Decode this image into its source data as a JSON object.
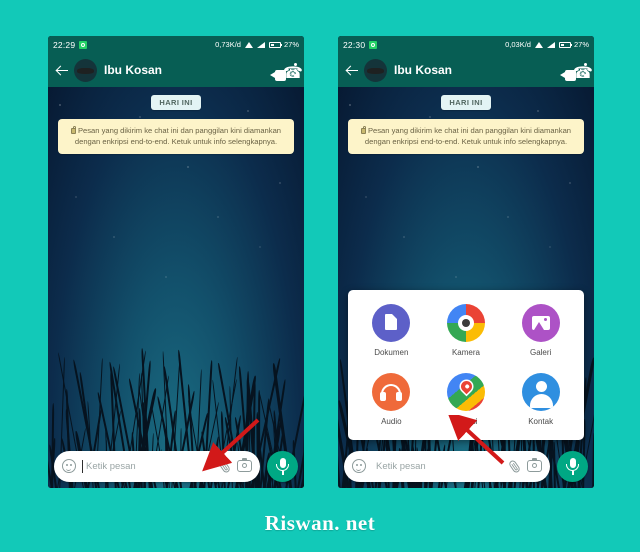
{
  "page": {
    "background_color": "#12c9b8",
    "watermark": "Riswan. net"
  },
  "phones": [
    {
      "id": "left",
      "status_bar": {
        "clock": "22:29",
        "app_icon": "whatsapp-icon",
        "net_speed": "0,73K/d",
        "wifi_icon": "wifi-icon",
        "signal_icon": "signal-icon",
        "battery_icon": "battery-icon",
        "battery_level": "27%"
      },
      "app_bar": {
        "back_icon": "back-arrow-icon",
        "avatar": "contact-avatar",
        "title": "Ibu Kosan",
        "video_call_icon": "video-call-icon",
        "voice_call_icon": "phone-call-icon",
        "overflow_icon": "more-options-icon"
      },
      "chat": {
        "day_divider": "HARI INI",
        "encryption_notice": "Pesan yang dikirim ke chat ini dan panggilan kini diamankan dengan enkripsi end-to-end. Ketuk untuk info selengkapnya.",
        "lock_icon": "lock-icon"
      },
      "input_bar": {
        "emoji_icon": "smiley-icon",
        "placeholder": "Ketik pesan",
        "value": "",
        "attach_icon": "paperclip-icon",
        "camera_icon": "camera-icon",
        "mic_icon": "microphone-icon"
      },
      "annotation": {
        "arrow": "red-arrow-pointing-to-attach-icon"
      }
    },
    {
      "id": "right",
      "status_bar": {
        "clock": "22:30",
        "app_icon": "whatsapp-icon",
        "net_speed": "0,03K/d",
        "wifi_icon": "wifi-icon",
        "signal_icon": "signal-icon",
        "battery_icon": "battery-icon",
        "battery_level": "27%"
      },
      "app_bar": {
        "back_icon": "back-arrow-icon",
        "avatar": "contact-avatar",
        "title": "Ibu Kosan",
        "video_call_icon": "video-call-icon",
        "voice_call_icon": "phone-call-icon",
        "overflow_icon": "more-options-icon"
      },
      "chat": {
        "day_divider": "HARI INI",
        "encryption_notice": "Pesan yang dikirim ke chat ini dan panggilan kini diamankan dengan enkripsi end-to-end. Ketuk untuk info selengkapnya.",
        "lock_icon": "lock-icon"
      },
      "attach_sheet": {
        "rows": [
          [
            {
              "label": "Dokumen",
              "icon": "document-icon",
              "color": "#5d60c8"
            },
            {
              "label": "Kamera",
              "icon": "camera-icon",
              "color": "#ea4335"
            },
            {
              "label": "Galeri",
              "icon": "gallery-icon",
              "color": "#ad52c6"
            }
          ],
          [
            {
              "label": "Audio",
              "icon": "headphones-icon",
              "color": "#ef6a3a"
            },
            {
              "label": "Lokasi",
              "icon": "location-pin-icon",
              "color": "#34a853"
            },
            {
              "label": "Kontak",
              "icon": "contact-person-icon",
              "color": "#2f8fe0"
            }
          ]
        ]
      },
      "input_bar": {
        "emoji_icon": "smiley-icon",
        "placeholder": "Ketik pesan",
        "value": "",
        "attach_icon": "paperclip-icon",
        "camera_icon": "camera-icon",
        "mic_icon": "microphone-icon"
      },
      "annotation": {
        "arrow": "red-arrow-pointing-to-lokasi-option"
      }
    }
  ]
}
